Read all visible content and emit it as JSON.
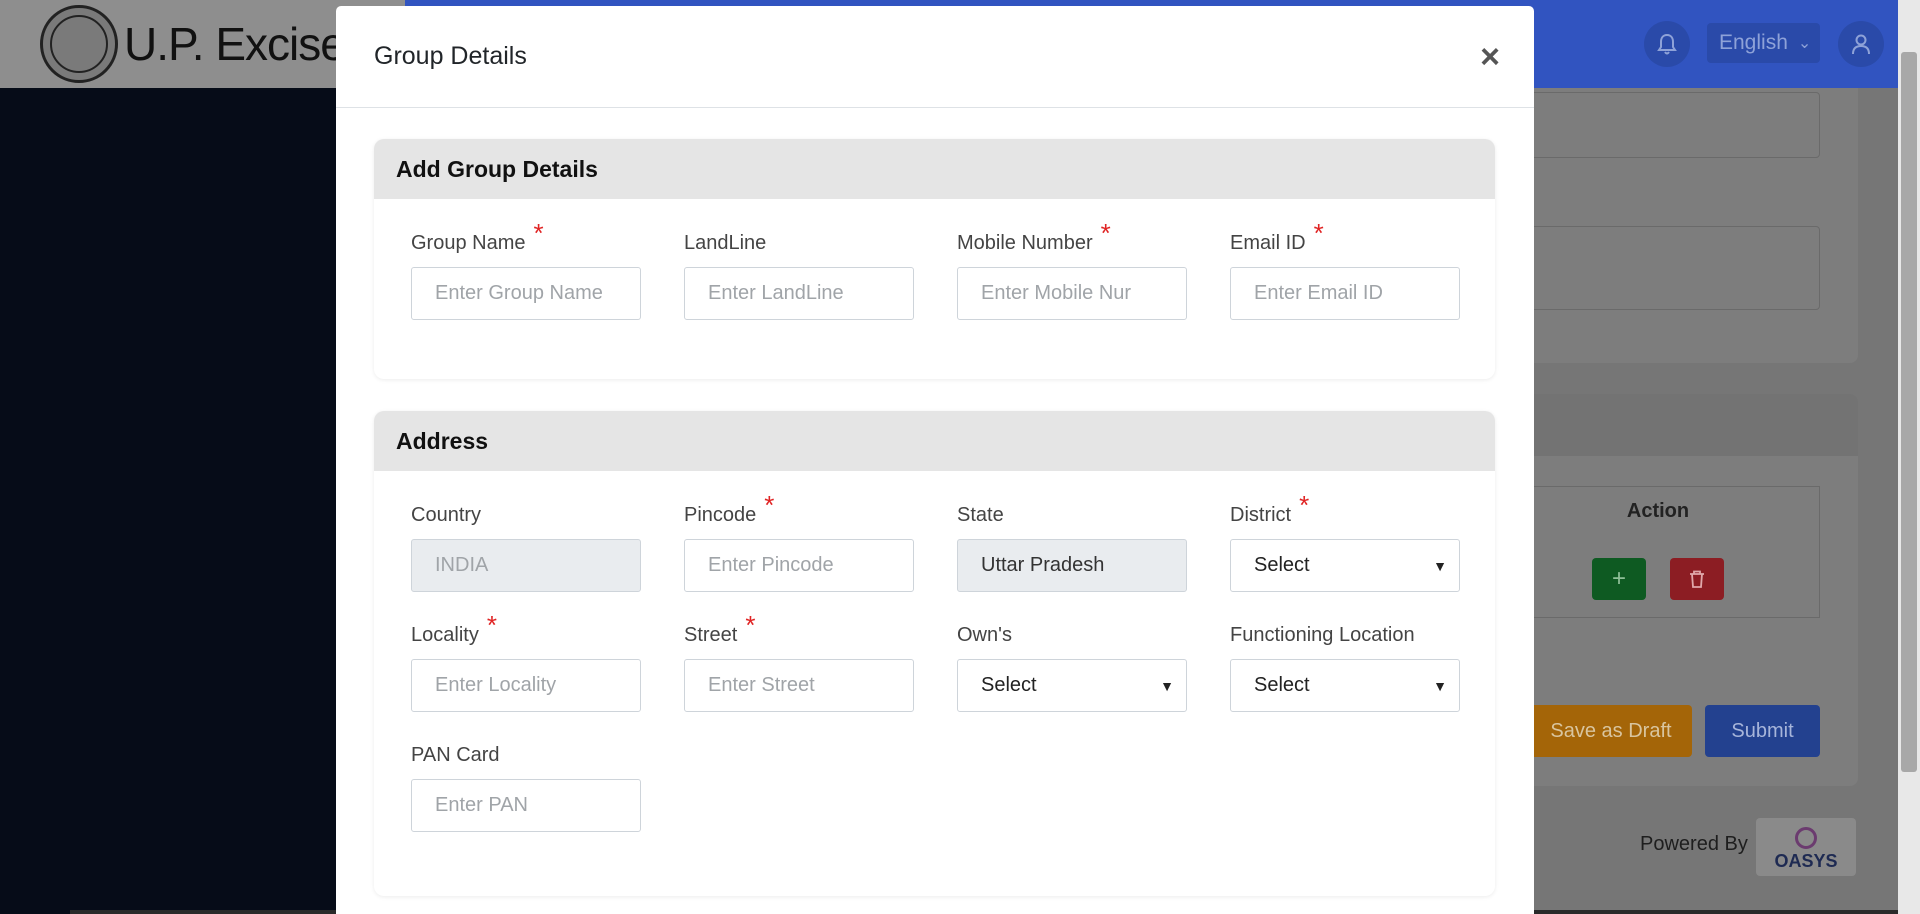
{
  "background": {
    "brand": "U.P. Excise",
    "language": "English",
    "table_action_header": "Action",
    "add_button_icon": "+",
    "save_draft_label": "Save as Draft",
    "submit_label": "Submit",
    "powered_by": "Powered By",
    "partner_logo_text": "OASYS"
  },
  "modal": {
    "title": "Group Details",
    "close_symbol": "×",
    "group_section": {
      "heading": "Add Group Details",
      "fields": [
        {
          "label": "Group Name",
          "required": "*",
          "placeholder": "Enter Group Name"
        },
        {
          "label": "LandLine",
          "placeholder": "Enter LandLine"
        },
        {
          "label": "Mobile Number",
          "required": "*",
          "placeholder": "Enter Mobile Nur"
        },
        {
          "label": "Email ID",
          "required": "*",
          "placeholder": "Enter Email ID"
        }
      ]
    },
    "address_section": {
      "heading": "Address",
      "country": {
        "label": "Country",
        "value": "INDIA"
      },
      "pincode": {
        "label": "Pincode",
        "required": "*",
        "placeholder": "Enter Pincode"
      },
      "state": {
        "label": "State",
        "value": "Uttar Pradesh"
      },
      "district": {
        "label": "District",
        "required": "*",
        "selected": "Select"
      },
      "locality": {
        "label": "Locality",
        "required": "*",
        "placeholder": "Enter Locality"
      },
      "street": {
        "label": "Street",
        "required": "*",
        "placeholder": "Enter Street"
      },
      "owns": {
        "label": "Own's",
        "selected": "Select"
      },
      "functioning_location": {
        "label": "Functioning Location",
        "selected": "Select"
      },
      "pan": {
        "label": "PAN Card",
        "placeholder": "Enter PAN"
      }
    }
  },
  "colors": {
    "header_blue": "#3154c0",
    "required_red": "#e02424",
    "section_head_gray": "#e5e5e5"
  }
}
